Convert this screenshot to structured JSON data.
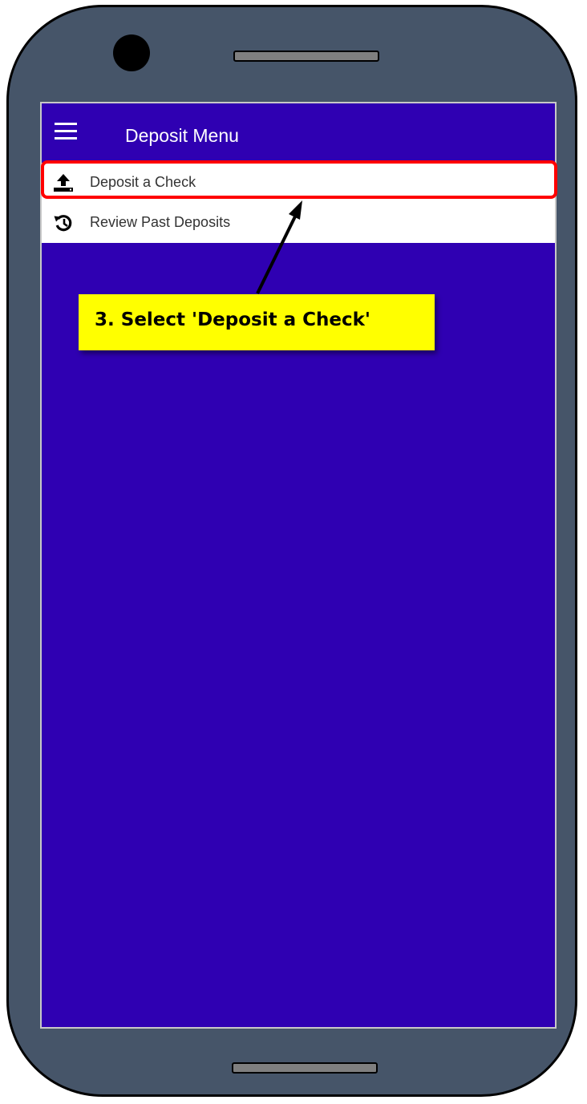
{
  "app": {
    "title": "Deposit Menu"
  },
  "menu": {
    "items": [
      {
        "label": "Deposit a Check",
        "icon": "upload-icon"
      },
      {
        "label": "Review Past Deposits",
        "icon": "history-icon"
      }
    ]
  },
  "annotation": {
    "callout_text": "3. Select 'Deposit a Check'"
  },
  "colors": {
    "phone_body": "#465569",
    "screen_background": "#2f00b2",
    "highlight": "#ff0000",
    "callout_background": "#ffff00"
  }
}
